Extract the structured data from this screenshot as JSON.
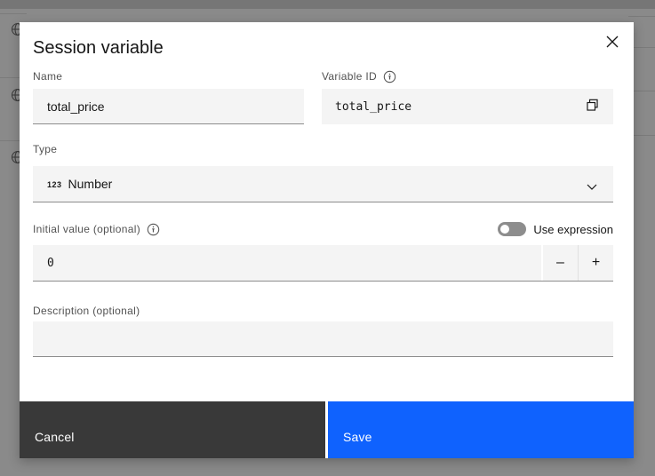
{
  "modal": {
    "title": "Session variable",
    "fields": {
      "name": {
        "label": "Name",
        "value": "total_price"
      },
      "variable_id": {
        "label": "Variable ID",
        "value": "total_price"
      },
      "type": {
        "label": "Type",
        "value": "Number",
        "icon_text": "123"
      },
      "initial_value": {
        "label": "Initial value (optional)",
        "value": "0",
        "toggle_label": "Use expression",
        "toggle_state": "off",
        "decrement_label": "–",
        "increment_label": "+"
      },
      "description": {
        "label": "Description (optional)",
        "value": "",
        "placeholder": ""
      }
    },
    "footer": {
      "cancel_label": "Cancel",
      "save_label": "Save"
    }
  },
  "colors": {
    "save_blue": "#0f62fe",
    "cancel_dark": "#393939",
    "field_background": "#f4f4f4",
    "field_border": "#8d8d8d",
    "label_gray": "#525252",
    "text_primary": "#161616",
    "toggle_off": "#8d8d8d",
    "overlay_gray": "#8a8a8a"
  }
}
